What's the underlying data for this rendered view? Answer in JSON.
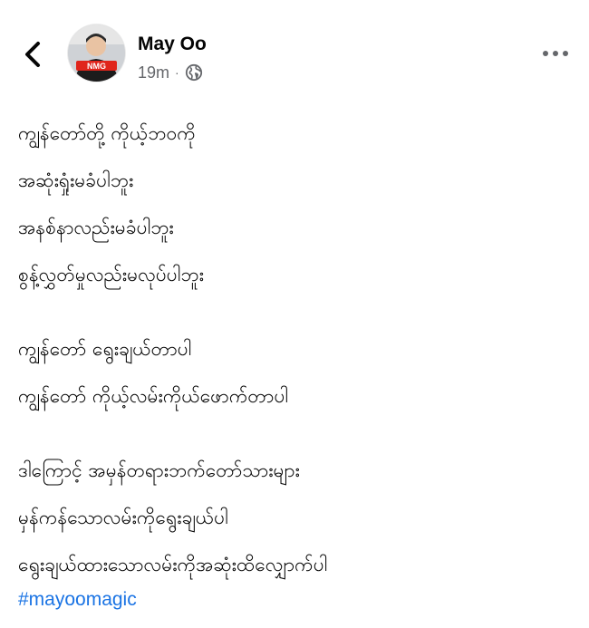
{
  "post": {
    "author": {
      "name": "May Oo",
      "avatar_icon": "profile-photo-avatar"
    },
    "time": "19m",
    "separator": "·",
    "audience_icon": "globe-icon",
    "lines": [
      "ကျွန်တော်တို့ ကိုယ့်ဘဝကို",
      "အဆုံးရှုံးမခံပါဘူး",
      "အနစ်နာလည်းမခံပါဘူး",
      "စွန့်လွှတ်မှုလည်းမလုပ်ပါဘူး",
      "ကျွန်တော် ရွေးချယ်တာပါ",
      "ကျွန်တော် ကိုယ့်လမ်းကိုယ်ဖောက်တာပါ",
      "ဒါကြောင့် အမှန်တရားဘက်တော်သားများ",
      "မှန်ကန်သောလမ်းကိုရွေးချယ်ပါ",
      "ရွေးချယ်ထားသောလမ်းကိုအဆုံးထိလျှောက်ပါ"
    ],
    "hashtag": "#mayoomagic"
  },
  "icons": {
    "back": "chevron-left-icon",
    "more": "more-dots-icon",
    "globe": "globe-icon"
  },
  "colors": {
    "text": "#050505",
    "secondary_text": "#65676b",
    "link": "#1b74e4",
    "background": "#ffffff"
  }
}
